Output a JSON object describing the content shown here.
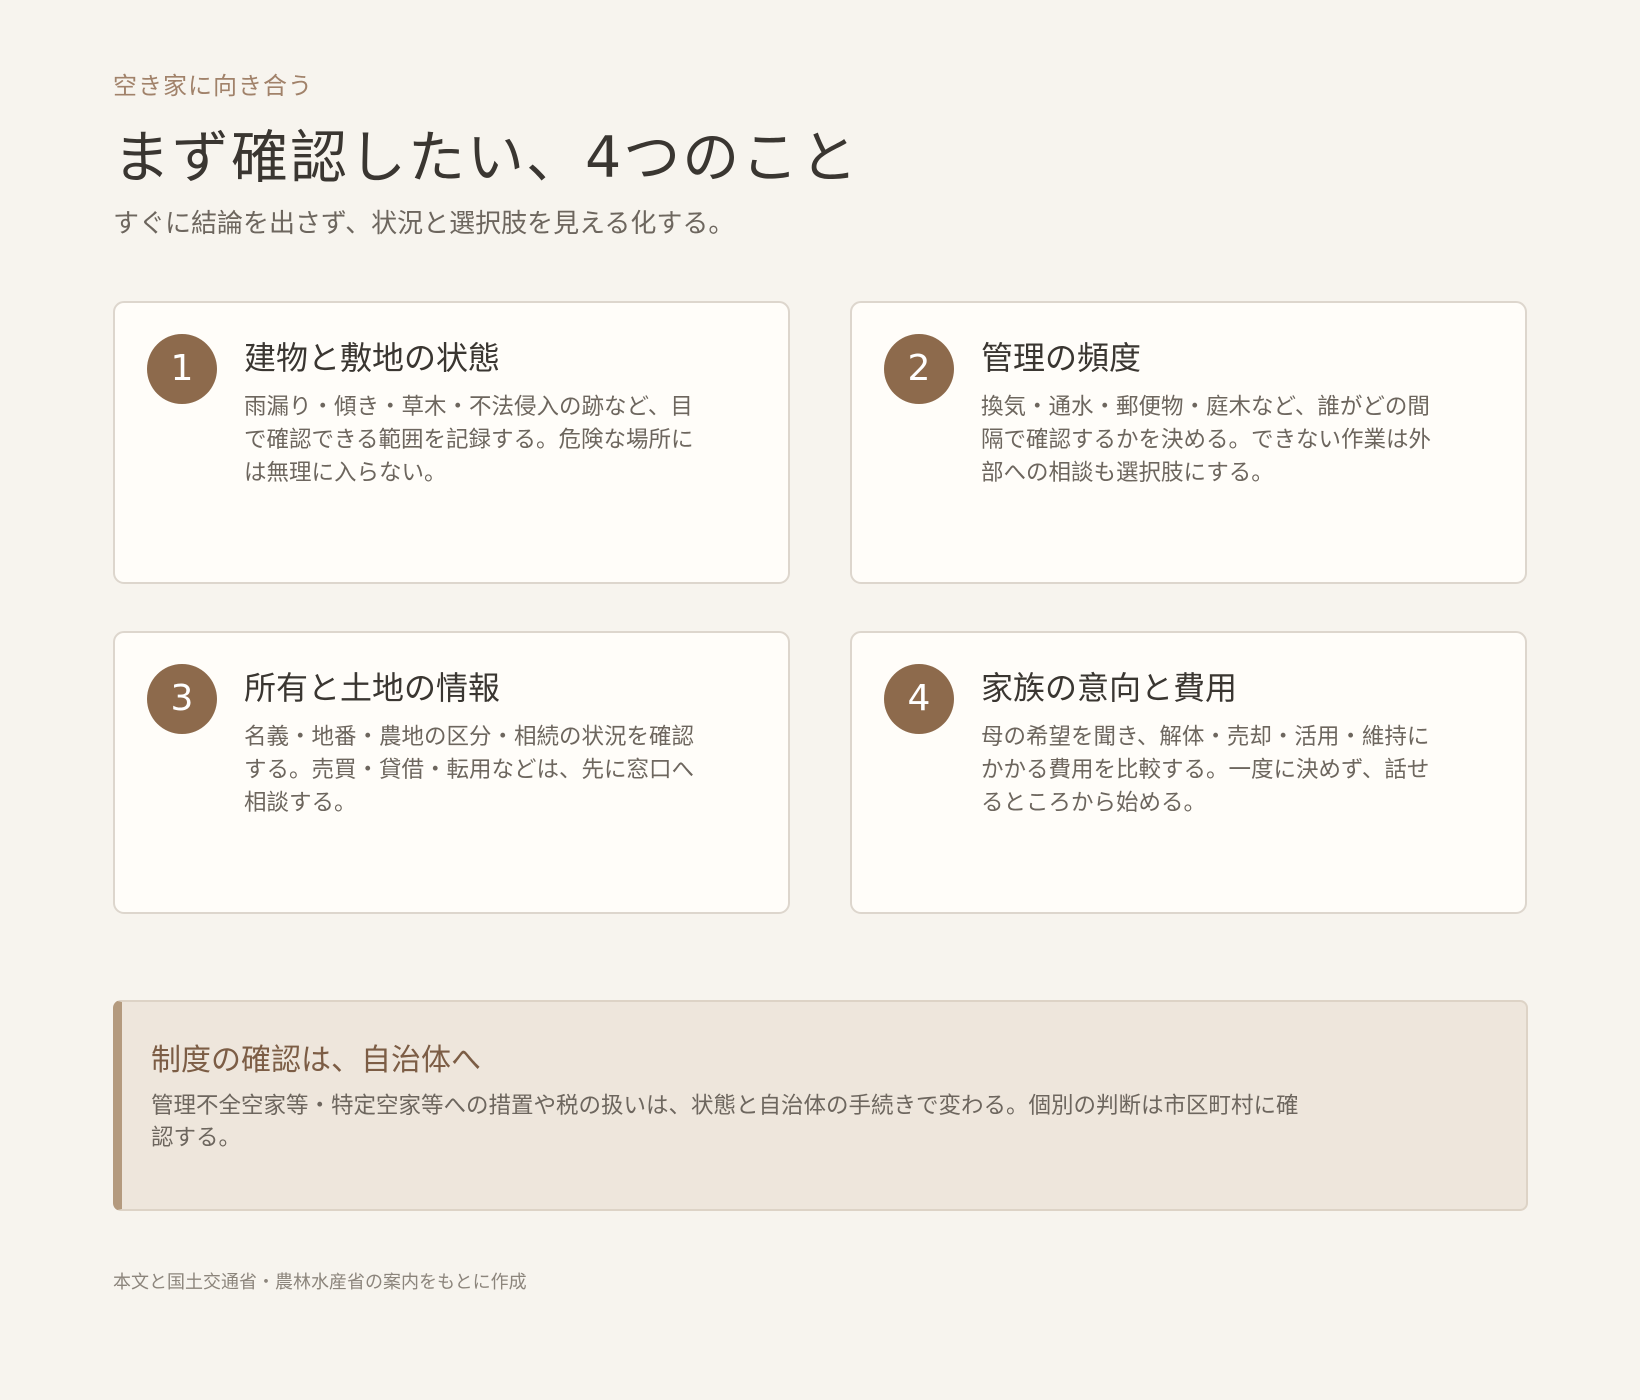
{
  "header": {
    "eyebrow": "空き家に向き合う",
    "title": "まず確認したい、4つのこと",
    "subtitle": "すぐに結論を出さず、状況と選択肢を見える化する。"
  },
  "cards": [
    {
      "number": "1",
      "title": "建物と敷地の状態",
      "body": "雨漏り・傾き・草木・不法侵入の跡など、目で確認できる範囲を記録する。危険な場所には無理に入らない。"
    },
    {
      "number": "2",
      "title": "管理の頻度",
      "body": "換気・通水・郵便物・庭木など、誰がどの間隔で確認するかを決める。できない作業は外部への相談も選択肢にする。"
    },
    {
      "number": "3",
      "title": "所有と土地の情報",
      "body": "名義・地番・農地の区分・相続の状況を確認する。売買・貸借・転用などは、先に窓口へ相談する。"
    },
    {
      "number": "4",
      "title": "家族の意向と費用",
      "body": "母の希望を聞き、解体・売却・活用・維持にかかる費用を比較する。一度に決めず、話せるところから始める。"
    }
  ],
  "notice": {
    "title": "制度の確認は、自治体へ",
    "body": "管理不全空家等・特定空家等への措置や税の扱いは、状態と自治体の手続きで変わる。個別の判断は市区町村に確認する。"
  },
  "footer": {
    "source": "本文と国土交通省・農林水産省の案内をもとに作成"
  },
  "colors": {
    "background": "#f7f4ee",
    "accent": "#8d6a4c",
    "notice_background": "#eee6dc",
    "notice_border": "#b49a7e"
  }
}
